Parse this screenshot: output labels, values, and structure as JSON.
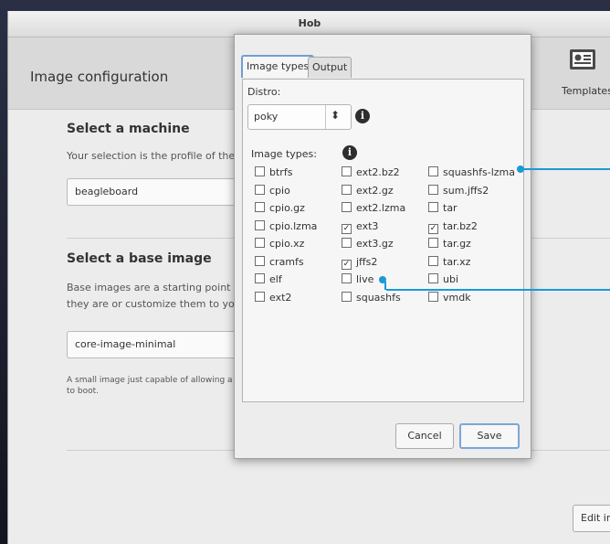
{
  "window": {
    "title": "Hob"
  },
  "header": {
    "title": "Image configuration",
    "templates_label": "Templates"
  },
  "machine": {
    "title": "Select a machine",
    "description": "Your selection is the profile of the t",
    "value": "beagleboard"
  },
  "base_image": {
    "title": "Select a base image",
    "description_line1": "Base images are a starting point for",
    "description_line2": "they are or customize them to your",
    "value": "core-image-minimal",
    "note_line1": "A small image just capable of allowing a de",
    "note_line2": "to boot."
  },
  "edit_button": {
    "label": "Edit im"
  },
  "dialog": {
    "tabs": [
      {
        "label": "Image types",
        "active": true
      },
      {
        "label": "Output",
        "active": false
      }
    ],
    "distro_label": "Distro:",
    "distro_value": "poky",
    "image_types_label": "Image types:",
    "image_types": [
      {
        "label": "btrfs",
        "checked": false
      },
      {
        "label": "cpio",
        "checked": false
      },
      {
        "label": "cpio.gz",
        "checked": false
      },
      {
        "label": "cpio.lzma",
        "checked": false
      },
      {
        "label": "cpio.xz",
        "checked": false
      },
      {
        "label": "cramfs",
        "checked": false
      },
      {
        "label": "elf",
        "checked": false
      },
      {
        "label": "ext2",
        "checked": false
      },
      {
        "label": "ext2.bz2",
        "checked": false
      },
      {
        "label": "ext2.gz",
        "checked": false
      },
      {
        "label": "ext2.lzma",
        "checked": false
      },
      {
        "label": "ext3",
        "checked": true
      },
      {
        "label": "ext3.gz",
        "checked": false
      },
      {
        "label": "jffs2",
        "checked": true
      },
      {
        "label": "live",
        "checked": false
      },
      {
        "label": "squashfs",
        "checked": false
      },
      {
        "label": "squashfs-lzma",
        "checked": false
      },
      {
        "label": "sum.jffs2",
        "checked": false
      },
      {
        "label": "tar",
        "checked": false
      },
      {
        "label": "tar.bz2",
        "checked": true
      },
      {
        "label": "tar.gz",
        "checked": false
      },
      {
        "label": "tar.xz",
        "checked": false
      },
      {
        "label": "ubi",
        "checked": false
      },
      {
        "label": "vmdk",
        "checked": false
      }
    ],
    "cancel_label": "Cancel",
    "save_label": "Save"
  },
  "icons": {
    "info": "info-icon",
    "templates": "templates-icon",
    "dropdown": "updown-arrows-icon"
  },
  "colors": {
    "accent": "#6f9fd2",
    "callout": "#1a9ad6"
  }
}
